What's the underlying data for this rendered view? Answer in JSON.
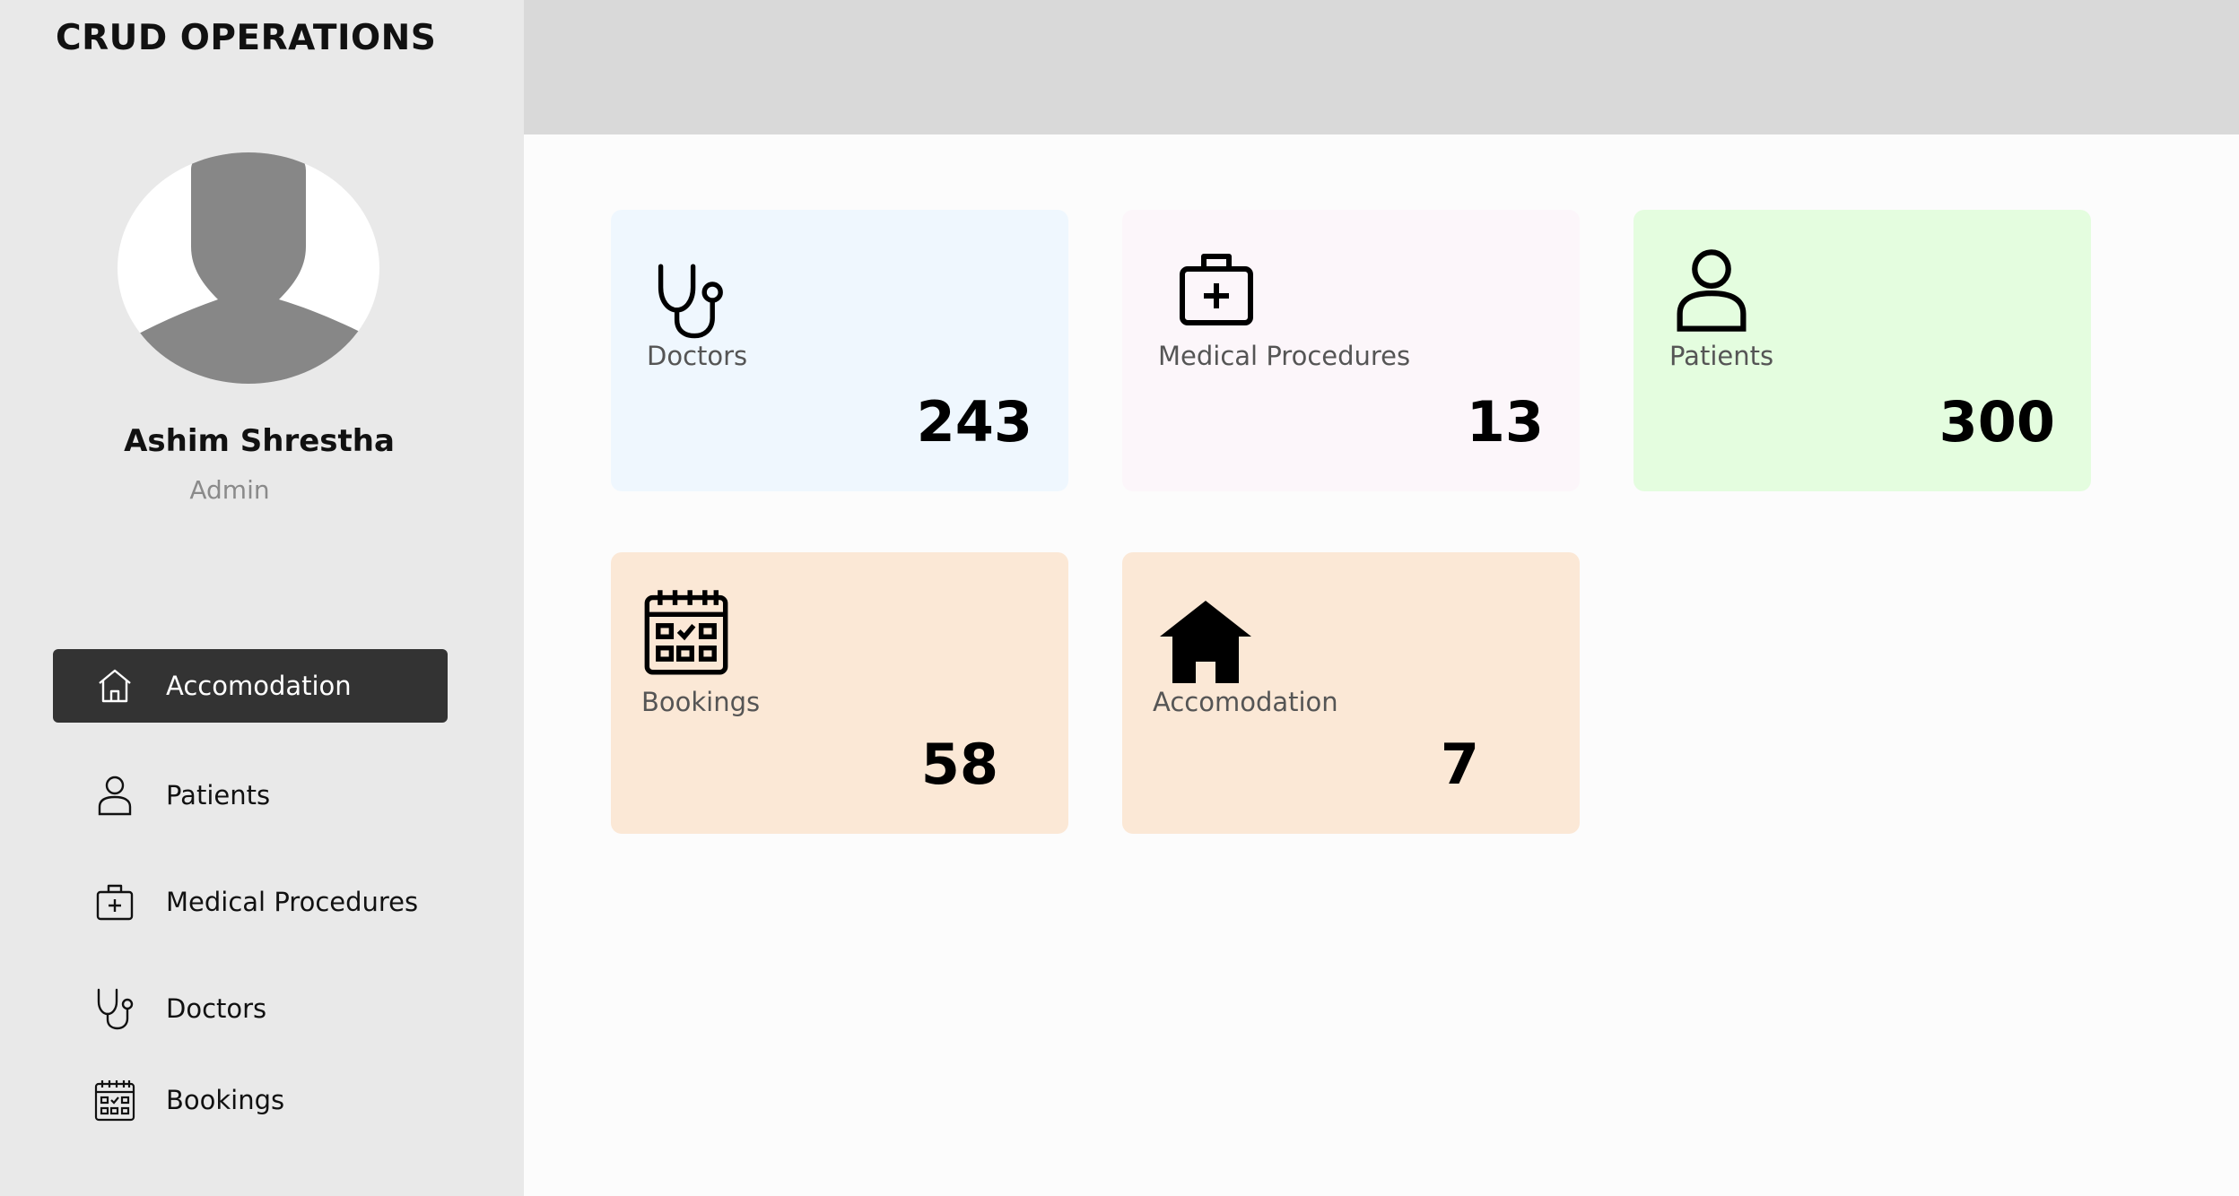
{
  "app": {
    "title": "CRUD OPERATIONS"
  },
  "user": {
    "name": "Ashim Shrestha",
    "role": "Admin"
  },
  "sidebar": {
    "items": [
      {
        "label": "Accomodation",
        "icon": "home-outline-icon",
        "active": true
      },
      {
        "label": "Patients",
        "icon": "user-icon",
        "active": false
      },
      {
        "label": "Medical Procedures",
        "icon": "medical-kit-icon",
        "active": false
      },
      {
        "label": "Doctors",
        "icon": "stethoscope-icon",
        "active": false
      },
      {
        "label": "Bookings",
        "icon": "calendar-icon",
        "active": false
      }
    ]
  },
  "cards": [
    {
      "label": "Doctors",
      "value": "243",
      "icon": "stethoscope-icon",
      "bg": "#eff7fe"
    },
    {
      "label": "Medical Procedures",
      "value": "13",
      "icon": "medical-kit-icon",
      "bg": "#fcf6fa"
    },
    {
      "label": "Patients",
      "value": "300",
      "icon": "user-icon",
      "bg": "#e4fddf"
    },
    {
      "label": "Bookings",
      "value": "58",
      "icon": "calendar-icon",
      "bg": "#fbe8d6"
    },
    {
      "label": "Accomodation",
      "value": "7",
      "icon": "home-filled-icon",
      "bg": "#fbe8d6"
    }
  ],
  "colors": {
    "sidebar_bg": "#e9e9e9",
    "active_item_bg": "#333333",
    "topbar_bg": "#d9d9d9",
    "content_bg": "#fcfcfc"
  }
}
